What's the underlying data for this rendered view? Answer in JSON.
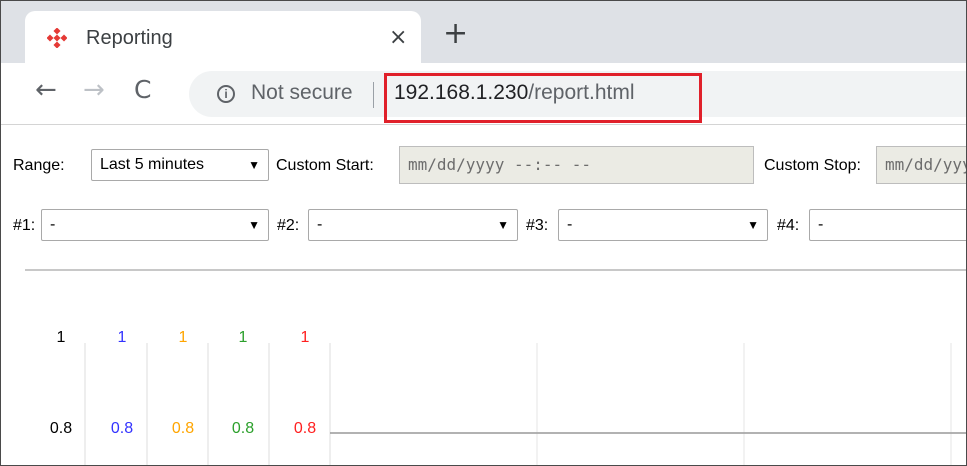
{
  "browser": {
    "tab_title": "Reporting",
    "tab_close": "×",
    "new_tab": "+",
    "back": "←",
    "forward": "→",
    "reload": "C",
    "info_icon": "i",
    "security_label": "Not secure",
    "url_host": "192.168.1.230",
    "url_path": "/report.html"
  },
  "controls": {
    "range_label": "Range:",
    "range_value": "Last 5 minutes",
    "custom_start_label": "Custom Start:",
    "custom_start_placeholder": "mm/dd/yyyy --:-- --",
    "custom_stop_label": "Custom Stop:",
    "custom_stop_placeholder": "mm/dd/yyyy --:-- --",
    "selectors": [
      {
        "label": "#1:",
        "value": "-"
      },
      {
        "label": "#2:",
        "value": "-"
      },
      {
        "label": "#3:",
        "value": "-"
      },
      {
        "label": "#4:",
        "value": "-"
      }
    ]
  },
  "chart_data": {
    "type": "line",
    "axes": [
      {
        "color": "#000000",
        "ticks": [
          "1",
          "0.8"
        ]
      },
      {
        "color": "#3333ff",
        "ticks": [
          "1",
          "0.8"
        ]
      },
      {
        "color": "#ffa500",
        "ticks": [
          "1",
          "0.8"
        ]
      },
      {
        "color": "#2ca02c",
        "ticks": [
          "1",
          "0.8"
        ]
      },
      {
        "color": "#ff2020",
        "ticks": [
          "1",
          "0.8"
        ]
      }
    ],
    "tick_values": [
      1,
      0.8
    ],
    "grid": true
  },
  "colors": {
    "highlight": "#e0202a",
    "favicon": "#e53935"
  }
}
